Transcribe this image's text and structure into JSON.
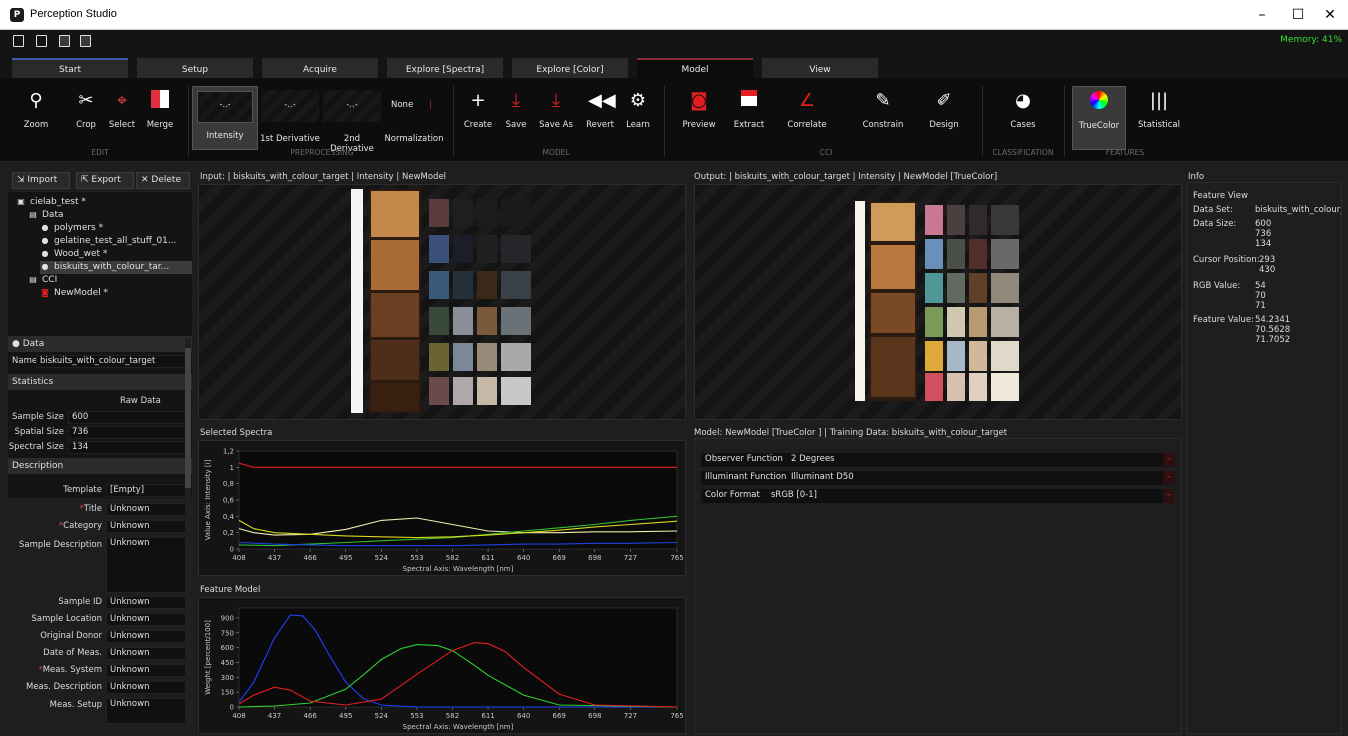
{
  "window": {
    "title": "Perception Studio",
    "minimize": "–",
    "maximize": "☐",
    "close": "✕"
  },
  "quickbar": {
    "memory": "Memory: 41%"
  },
  "tabs": [
    "Start",
    "Setup",
    "Acquire",
    "Explore [Spectra]",
    "Explore [Color]",
    "Model",
    "View"
  ],
  "ribbon": {
    "edit": {
      "zoom": "Zoom",
      "crop": "Crop",
      "select": "Select",
      "merge": "Merge",
      "group": "EDIT"
    },
    "preprocessing": {
      "intensity": "Intensity",
      "d1": "1st Derivative",
      "d2": "2nd Derivative",
      "none": "None",
      "normalization": "Normalization",
      "group": "PREPROCESSING"
    },
    "model": {
      "create": "Create",
      "save": "Save",
      "saveas": "Save As",
      "revert": "Revert",
      "learn": "Learn",
      "group": "MODEL"
    },
    "cci": {
      "preview": "Preview",
      "extract": "Extract",
      "correlate": "Correlate",
      "constrain": "Constrain",
      "design": "Design",
      "group": "CCI"
    },
    "classification": {
      "cases": "Cases",
      "group": "CLASSIFICATION"
    },
    "features": {
      "truecolor": "TrueColor",
      "statistical": "Statistical",
      "group": "FEATURES"
    }
  },
  "left": {
    "import": "Import",
    "export": "Export",
    "delete": "Delete",
    "tree": [
      "cielab_test *",
      "Data",
      "polymers *",
      "gelatine_test_all_stuff_01...",
      "Wood_wet *",
      "biskuits_with_colour_tar...",
      "CCI",
      "NewModel *"
    ],
    "data_header": "Data",
    "name_label": "Name",
    "name_value": "biskuits_with_colour_target",
    "statistics": "Statistics",
    "raw_data": "Raw Data",
    "sample_size_label": "Sample Size",
    "sample_size": "600",
    "spatial_size_label": "Spatial Size",
    "spatial_size": "736",
    "spectral_size_label": "Spectral Size",
    "spectral_size": "134",
    "description": "Description",
    "fields": [
      {
        "label": "Template",
        "value": "[Empty]"
      },
      {
        "label": "Title",
        "value": "Unknown"
      },
      {
        "label": "Category",
        "value": "Unknown"
      },
      {
        "label": "Sample Description",
        "value": "Unknown"
      },
      {
        "label": "Sample ID",
        "value": "Unknown"
      },
      {
        "label": "Sample Location",
        "value": "Unknown"
      },
      {
        "label": "Original Donor",
        "value": "Unknown"
      },
      {
        "label": "Date of Meas.",
        "value": "Unknown"
      },
      {
        "label": "Meas. System",
        "value": "Unknown"
      },
      {
        "label": "Meas. Description",
        "value": "Unknown"
      },
      {
        "label": "Meas. Setup",
        "value": "Unknown"
      }
    ],
    "required_mark": "*"
  },
  "panes": {
    "input_title": "Input: | biskuits_with_colour_target | Intensity | NewModel",
    "output_title": "Output: | biskuits_with_colour_target | Intensity | NewModel [TrueColor]",
    "spectra_title": "Selected Spectra",
    "feature_title": "Feature Model",
    "model_title": "Model: NewModel [TrueColor ] | Training Data: biskuits_with_colour_target"
  },
  "model": [
    {
      "label": "Observer Function",
      "value": "2 Degrees"
    },
    {
      "label": "Illuminant Function",
      "value": "Illuminant D50"
    },
    {
      "label": "Color Format",
      "value": "sRGB [0-1]"
    }
  ],
  "info": {
    "title": "Info",
    "feature_view": "Feature View",
    "dataset_label": "Data Set:",
    "dataset": "biskuits_with_colour_t",
    "datasize_label": "Data Size:",
    "datasize": "600\n736\n134",
    "cursor_label": "Cursor Position:",
    "cursor": "293\n430",
    "rgb_label": "RGB Value:",
    "rgb": "54\n70\n71",
    "feature_label": "Feature Value:",
    "feature": "54.2341\n70.5628\n71.7052"
  },
  "chart_data": [
    {
      "type": "line",
      "title": "Selected Spectra",
      "xlabel": "Spectral Axis: Wavelength [nm]",
      "ylabel": "Value Axis: Intensity [i]",
      "xticks": [
        "408",
        "437",
        "466",
        "495",
        "524",
        "553",
        "582",
        "611",
        "640",
        "669",
        "698",
        "727",
        "765"
      ],
      "yticks": [
        "0",
        "0,2",
        "0,4",
        "0,6",
        "0,8",
        "1",
        "1,2"
      ],
      "xlim": [
        408,
        765
      ],
      "ylim": [
        0,
        1.2
      ],
      "series": [
        {
          "color": "#e02020",
          "x": [
            408,
            420,
            437,
            466,
            495,
            524,
            553,
            582,
            611,
            640,
            669,
            698,
            727,
            765
          ],
          "y": [
            1.05,
            1.0,
            1.0,
            1.0,
            1.0,
            1.0,
            1.0,
            1.0,
            1.0,
            1.0,
            1.0,
            1.0,
            1.0,
            1.0
          ]
        },
        {
          "color": "#f0f0b0",
          "x": [
            408,
            420,
            437,
            466,
            495,
            524,
            553,
            582,
            611,
            640,
            669,
            698,
            727,
            765
          ],
          "y": [
            0.25,
            0.2,
            0.17,
            0.18,
            0.24,
            0.35,
            0.38,
            0.3,
            0.22,
            0.2,
            0.2,
            0.21,
            0.21,
            0.22
          ]
        },
        {
          "color": "#30c030",
          "x": [
            408,
            437,
            466,
            495,
            524,
            553,
            582,
            611,
            640,
            669,
            698,
            727,
            765
          ],
          "y": [
            0.05,
            0.04,
            0.06,
            0.08,
            0.1,
            0.12,
            0.14,
            0.18,
            0.22,
            0.26,
            0.3,
            0.35,
            0.4
          ]
        },
        {
          "color": "#d8d820",
          "x": [
            408,
            420,
            437,
            466,
            495,
            524,
            553,
            582,
            611,
            640,
            669,
            698,
            727,
            765
          ],
          "y": [
            0.35,
            0.25,
            0.2,
            0.18,
            0.16,
            0.15,
            0.14,
            0.15,
            0.17,
            0.2,
            0.23,
            0.27,
            0.3,
            0.34
          ]
        },
        {
          "color": "#2040e0",
          "x": [
            408,
            437,
            466,
            495,
            524,
            553,
            582,
            611,
            640,
            669,
            698,
            727,
            765
          ],
          "y": [
            0.08,
            0.06,
            0.05,
            0.04,
            0.04,
            0.04,
            0.04,
            0.05,
            0.06,
            0.06,
            0.07,
            0.07,
            0.08
          ]
        }
      ]
    },
    {
      "type": "line",
      "title": "Feature Model",
      "xlabel": "Spectral Axis: Wavelength [nm]",
      "ylabel": "Weight [percent/100]",
      "xticks": [
        "408",
        "437",
        "466",
        "495",
        "524",
        "553",
        "582",
        "611",
        "640",
        "669",
        "698",
        "727",
        "765"
      ],
      "yticks": [
        "0",
        "150",
        "300",
        "450",
        "600",
        "750",
        "900"
      ],
      "xlim": [
        408,
        765
      ],
      "ylim": [
        0,
        1000
      ],
      "series": [
        {
          "color": "#2040ff",
          "x": [
            408,
            420,
            437,
            450,
            460,
            470,
            480,
            495,
            510,
            524,
            553,
            582,
            611,
            765
          ],
          "y": [
            50,
            250,
            700,
            930,
            920,
            780,
            560,
            250,
            80,
            20,
            0,
            0,
            0,
            0
          ]
        },
        {
          "color": "#30d030",
          "x": [
            408,
            437,
            466,
            495,
            510,
            524,
            540,
            553,
            570,
            582,
            600,
            611,
            640,
            669,
            765
          ],
          "y": [
            0,
            10,
            40,
            180,
            330,
            480,
            590,
            630,
            620,
            570,
            420,
            320,
            120,
            20,
            0
          ]
        },
        {
          "color": "#e02020",
          "x": [
            408,
            420,
            437,
            450,
            466,
            495,
            524,
            553,
            582,
            600,
            611,
            625,
            640,
            669,
            698,
            765
          ],
          "y": [
            30,
            120,
            200,
            170,
            60,
            20,
            80,
            330,
            570,
            650,
            640,
            560,
            400,
            130,
            20,
            0
          ]
        }
      ]
    }
  ]
}
